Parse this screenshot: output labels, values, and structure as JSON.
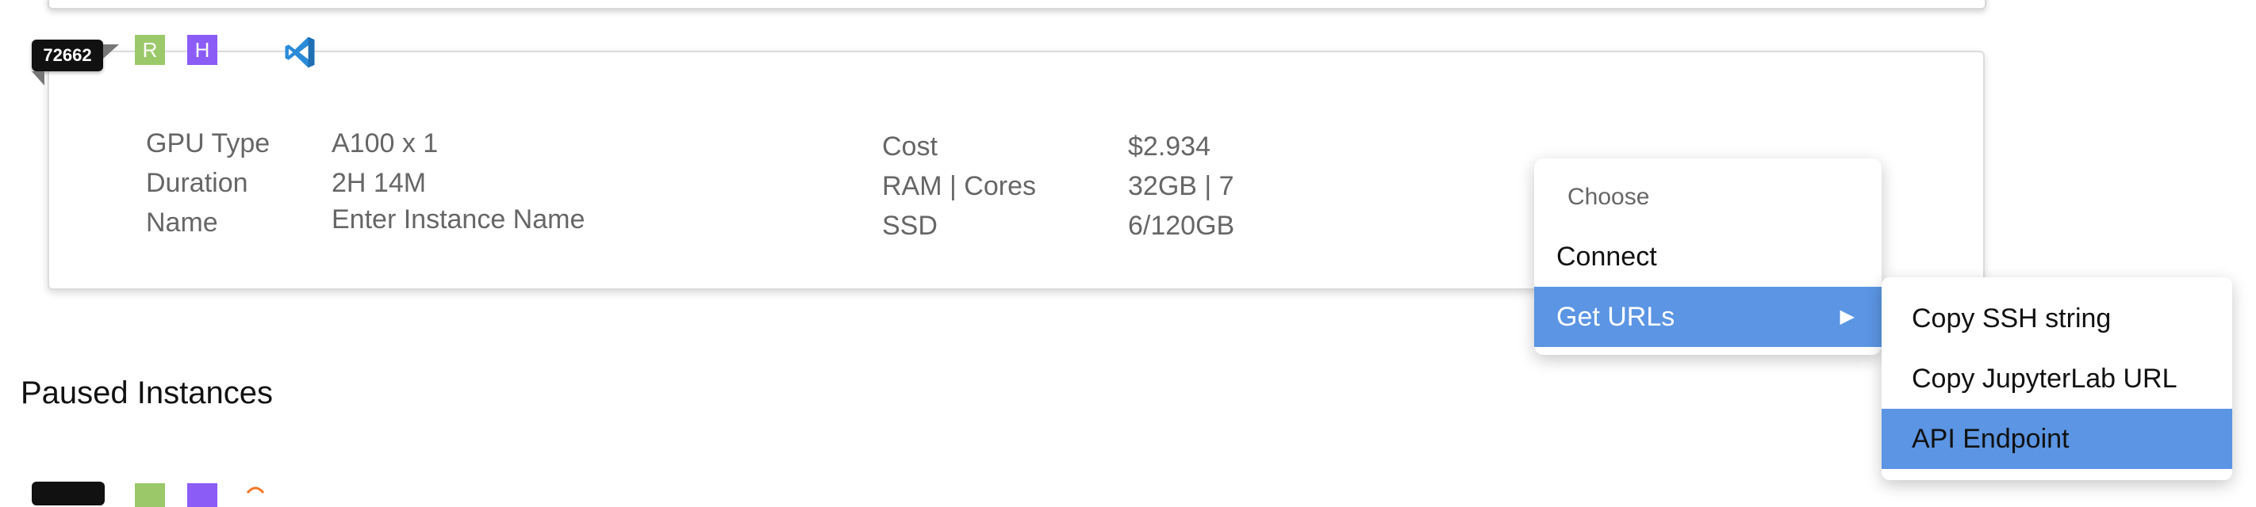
{
  "instance": {
    "id": "72662",
    "tags": {
      "r": "R",
      "h": "H"
    },
    "ide_icon": "vscode-icon",
    "fields_left": [
      {
        "label": "GPU Type",
        "value": "A100 x 1"
      },
      {
        "label": "Duration",
        "value": "2H 14M"
      },
      {
        "label": "Name",
        "value": "Enter Instance Name"
      }
    ],
    "fields_right": [
      {
        "label": "Cost",
        "value": "$2.934"
      },
      {
        "label": "RAM | Cores",
        "value": "32GB | 7"
      },
      {
        "label": "SSD",
        "value": "6/120GB"
      }
    ]
  },
  "section": {
    "paused_title": "Paused Instances"
  },
  "menu": {
    "header": "Choose",
    "items": [
      {
        "label": "Connect"
      },
      {
        "label": "Get URLs",
        "has_submenu": true,
        "arrow": "▶"
      }
    ]
  },
  "submenu": {
    "items": [
      {
        "label": "Copy SSH string"
      },
      {
        "label": "Copy JupyterLab URL"
      },
      {
        "label": "API Endpoint"
      }
    ]
  },
  "colors": {
    "highlight": "#5b95e3",
    "tag_r": "#9bc96a",
    "tag_h": "#8b5cf6",
    "badge": "#111111"
  }
}
